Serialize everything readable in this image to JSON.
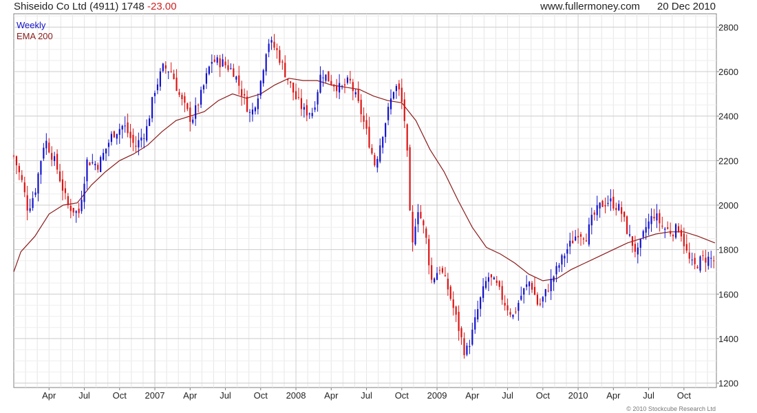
{
  "header": {
    "title": "Shiseido Co Ltd (4911) 1748",
    "change": "-23.00",
    "site": "www.fullermoney.com",
    "date": "20 Dec 2010"
  },
  "legend": {
    "period": "Weekly",
    "ema": "EMA 200"
  },
  "copyright": "© 2010 Stockcube Research Ltd",
  "colors": {
    "up": "#1010cc",
    "down": "#dd1111",
    "ema": "#8b1a1a",
    "grid": "#cccccc",
    "frame": "#808080"
  },
  "chart_data": {
    "type": "candlestick",
    "ylim": [
      1180,
      2860
    ],
    "yticks": [
      1200,
      1400,
      1600,
      1800,
      2000,
      2200,
      2400,
      2600,
      2800
    ],
    "xlim": [
      2006.0,
      2010.98
    ],
    "xticks": [
      {
        "label": "Apr",
        "t": 2006.25
      },
      {
        "label": "Jul",
        "t": 2006.5
      },
      {
        "label": "Oct",
        "t": 2006.75
      },
      {
        "label": "2007",
        "t": 2007.0
      },
      {
        "label": "Apr",
        "t": 2007.25
      },
      {
        "label": "Jul",
        "t": 2007.5
      },
      {
        "label": "Oct",
        "t": 2007.75
      },
      {
        "label": "2008",
        "t": 2008.0
      },
      {
        "label": "Apr",
        "t": 2008.25
      },
      {
        "label": "Jul",
        "t": 2008.5
      },
      {
        "label": "Oct",
        "t": 2008.75
      },
      {
        "label": "2009",
        "t": 2009.0
      },
      {
        "label": "Apr",
        "t": 2009.25
      },
      {
        "label": "Jul",
        "t": 2009.5
      },
      {
        "label": "Oct",
        "t": 2009.75
      },
      {
        "label": "2010",
        "t": 2010.0
      },
      {
        "label": "Apr",
        "t": 2010.25
      },
      {
        "label": "Jul",
        "t": 2010.5
      },
      {
        "label": "Oct",
        "t": 2010.75
      }
    ],
    "close_anchors": [
      [
        2006.0,
        2220
      ],
      [
        2006.06,
        2100
      ],
      [
        2006.1,
        1980
      ],
      [
        2006.15,
        2060
      ],
      [
        2006.22,
        2300
      ],
      [
        2006.3,
        2180
      ],
      [
        2006.38,
        2000
      ],
      [
        2006.46,
        1960
      ],
      [
        2006.52,
        2200
      ],
      [
        2006.6,
        2180
      ],
      [
        2006.7,
        2320
      ],
      [
        2006.78,
        2360
      ],
      [
        2006.86,
        2260
      ],
      [
        2006.94,
        2340
      ],
      [
        2007.0,
        2520
      ],
      [
        2007.06,
        2620
      ],
      [
        2007.12,
        2600
      ],
      [
        2007.18,
        2480
      ],
      [
        2007.26,
        2380
      ],
      [
        2007.32,
        2480
      ],
      [
        2007.4,
        2650
      ],
      [
        2007.48,
        2640
      ],
      [
        2007.56,
        2600
      ],
      [
        2007.62,
        2500
      ],
      [
        2007.68,
        2400
      ],
      [
        2007.74,
        2520
      ],
      [
        2007.8,
        2740
      ],
      [
        2007.86,
        2700
      ],
      [
        2007.92,
        2600
      ],
      [
        2008.0,
        2480
      ],
      [
        2008.06,
        2420
      ],
      [
        2008.12,
        2420
      ],
      [
        2008.18,
        2600
      ],
      [
        2008.24,
        2560
      ],
      [
        2008.32,
        2520
      ],
      [
        2008.38,
        2560
      ],
      [
        2008.46,
        2420
      ],
      [
        2008.52,
        2280
      ],
      [
        2008.56,
        2180
      ],
      [
        2008.62,
        2340
      ],
      [
        2008.7,
        2540
      ],
      [
        2008.74,
        2500
      ],
      [
        2008.78,
        2340
      ],
      [
        2008.82,
        1780
      ],
      [
        2008.86,
        2000
      ],
      [
        2008.92,
        1860
      ],
      [
        2008.96,
        1660
      ],
      [
        2009.02,
        1720
      ],
      [
        2009.08,
        1620
      ],
      [
        2009.14,
        1480
      ],
      [
        2009.2,
        1330
      ],
      [
        2009.24,
        1400
      ],
      [
        2009.3,
        1560
      ],
      [
        2009.36,
        1680
      ],
      [
        2009.42,
        1640
      ],
      [
        2009.48,
        1560
      ],
      [
        2009.54,
        1500
      ],
      [
        2009.6,
        1600
      ],
      [
        2009.66,
        1660
      ],
      [
        2009.72,
        1540
      ],
      [
        2009.78,
        1620
      ],
      [
        2009.84,
        1700
      ],
      [
        2009.92,
        1800
      ],
      [
        2010.0,
        1880
      ],
      [
        2010.06,
        1860
      ],
      [
        2010.1,
        1940
      ],
      [
        2010.16,
        2000
      ],
      [
        2010.22,
        2020
      ],
      [
        2010.3,
        1980
      ],
      [
        2010.36,
        1860
      ],
      [
        2010.42,
        1780
      ],
      [
        2010.48,
        1900
      ],
      [
        2010.54,
        1960
      ],
      [
        2010.6,
        1900
      ],
      [
        2010.66,
        1880
      ],
      [
        2010.72,
        1900
      ],
      [
        2010.78,
        1760
      ],
      [
        2010.82,
        1720
      ],
      [
        2010.88,
        1760
      ],
      [
        2010.94,
        1760
      ],
      [
        2010.97,
        1748
      ]
    ],
    "ema200": [
      [
        2006.0,
        1700
      ],
      [
        2006.05,
        1790
      ],
      [
        2006.15,
        1860
      ],
      [
        2006.25,
        1960
      ],
      [
        2006.35,
        2000
      ],
      [
        2006.45,
        2010
      ],
      [
        2006.55,
        2090
      ],
      [
        2006.65,
        2150
      ],
      [
        2006.75,
        2200
      ],
      [
        2006.85,
        2230
      ],
      [
        2006.95,
        2270
      ],
      [
        2007.05,
        2330
      ],
      [
        2007.15,
        2380
      ],
      [
        2007.25,
        2400
      ],
      [
        2007.35,
        2420
      ],
      [
        2007.45,
        2470
      ],
      [
        2007.55,
        2500
      ],
      [
        2007.65,
        2480
      ],
      [
        2007.75,
        2500
      ],
      [
        2007.85,
        2540
      ],
      [
        2007.95,
        2570
      ],
      [
        2008.05,
        2560
      ],
      [
        2008.15,
        2560
      ],
      [
        2008.25,
        2540
      ],
      [
        2008.35,
        2530
      ],
      [
        2008.45,
        2520
      ],
      [
        2008.55,
        2490
      ],
      [
        2008.65,
        2470
      ],
      [
        2008.75,
        2460
      ],
      [
        2008.85,
        2380
      ],
      [
        2008.95,
        2250
      ],
      [
        2009.05,
        2150
      ],
      [
        2009.15,
        2020
      ],
      [
        2009.25,
        1900
      ],
      [
        2009.35,
        1810
      ],
      [
        2009.45,
        1780
      ],
      [
        2009.55,
        1740
      ],
      [
        2009.65,
        1690
      ],
      [
        2009.75,
        1660
      ],
      [
        2009.85,
        1670
      ],
      [
        2009.95,
        1710
      ],
      [
        2010.05,
        1740
      ],
      [
        2010.15,
        1770
      ],
      [
        2010.25,
        1800
      ],
      [
        2010.35,
        1830
      ],
      [
        2010.45,
        1850
      ],
      [
        2010.55,
        1870
      ],
      [
        2010.65,
        1880
      ],
      [
        2010.75,
        1880
      ],
      [
        2010.85,
        1860
      ],
      [
        2010.97,
        1830
      ]
    ]
  }
}
